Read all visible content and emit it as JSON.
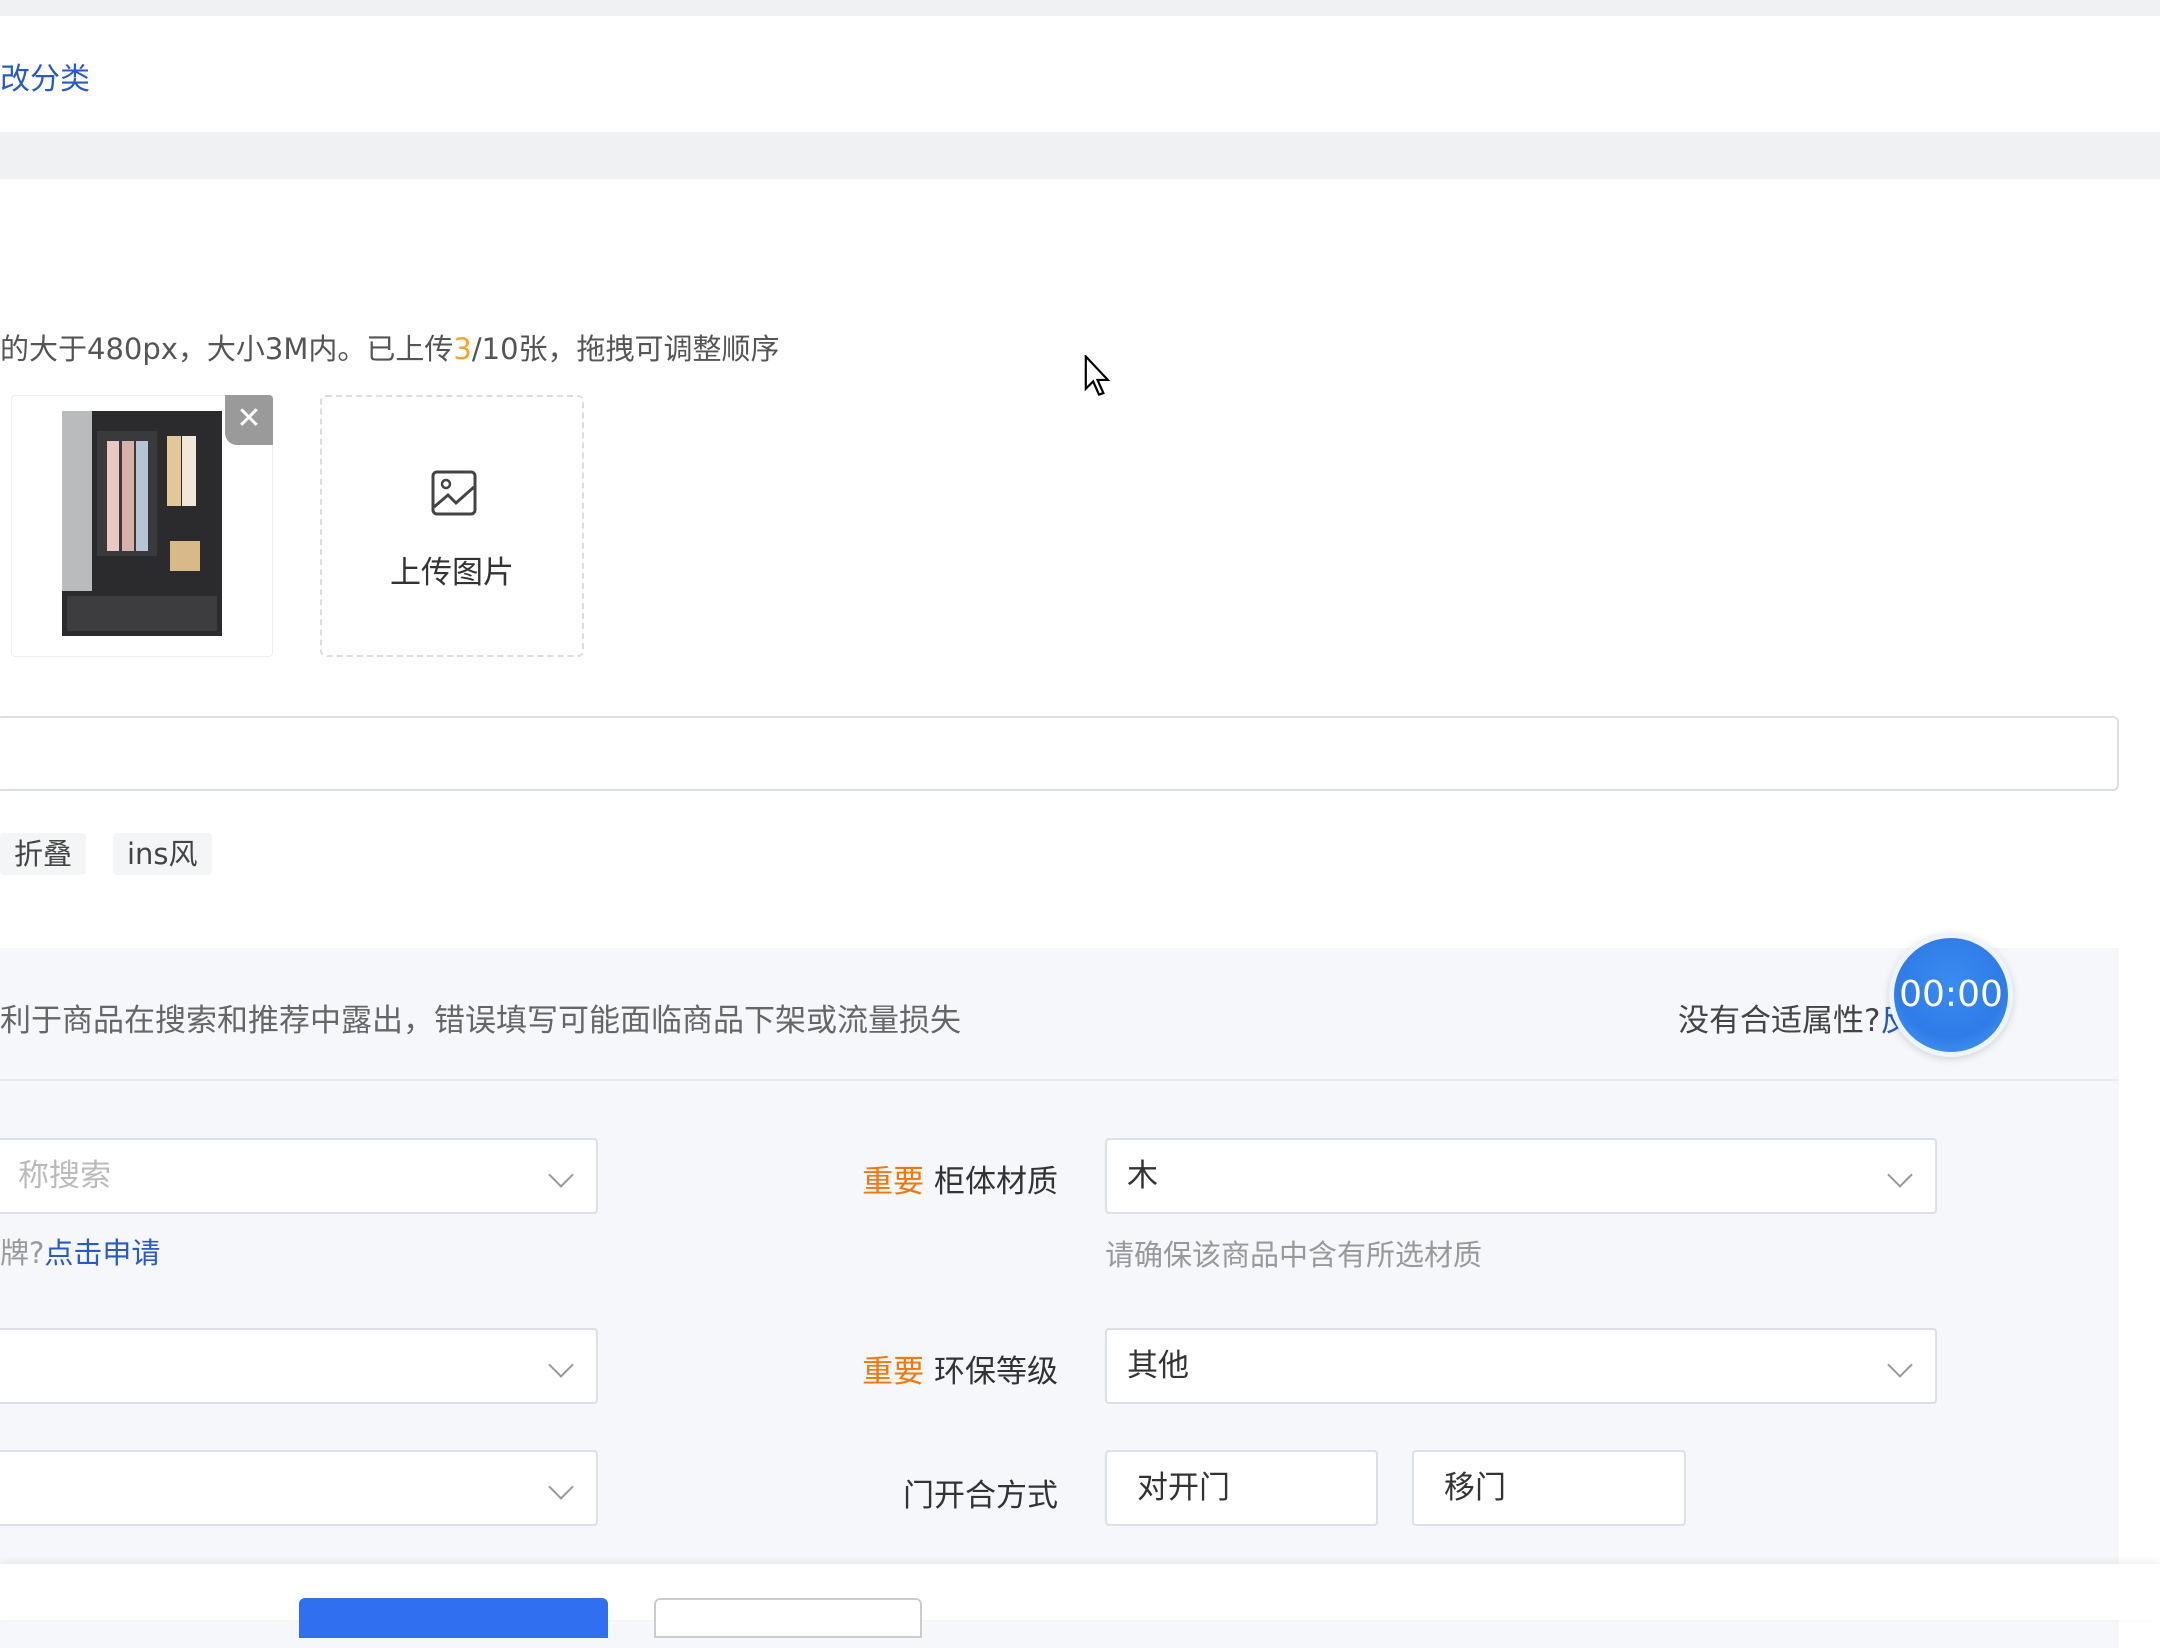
{
  "breadcrumb": {
    "text": "改分类"
  },
  "images": {
    "hint_before": "的大于480px，大小3M内。已上传",
    "uploaded": "3",
    "hint_after": "/10张，拖拽可调整顺序",
    "upload_label": "上传图片"
  },
  "tags": [
    "折叠",
    "ins风"
  ],
  "attributes": {
    "notice": "利于商品在搜索和推荐中露出，错误填写可能面临商品下架或流量损失",
    "no_fit": "没有合适属性?",
    "feedback": "反馈",
    "timer": "00:00",
    "brand_placeholder": "称搜索",
    "brand_help_prefix": "牌?",
    "brand_help_link": "点击申请",
    "important": "重要",
    "material_label": "柜体材质",
    "material_value": "木",
    "material_help": "请确保该商品中含有所选材质",
    "eco_label": "环保等级",
    "eco_value": "其他",
    "door_label": "门开合方式",
    "door_options": [
      "对开门",
      "移门"
    ]
  },
  "colors": {
    "accent": "#2f6ff0",
    "important": "#f5760a",
    "timer": "#2f7be8"
  }
}
